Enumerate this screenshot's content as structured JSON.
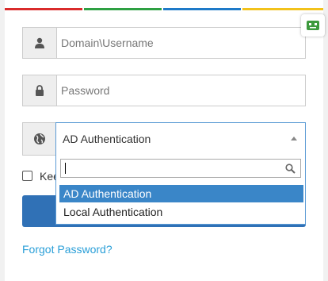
{
  "colors": {
    "stripe_red": "#d92b2b",
    "stripe_green": "#2ea043",
    "stripe_blue": "#1e7ac8",
    "stripe_yellow": "#f2c21b",
    "primary_button": "#3071b6",
    "selected_option": "#3a86c8",
    "link": "#2a9fd8"
  },
  "username": {
    "placeholder": "Domain\\Username",
    "icon": "user-icon"
  },
  "password": {
    "placeholder": "Password",
    "icon": "lock-icon"
  },
  "auth_select": {
    "icon": "globe-icon",
    "selected_value": "AD Authentication",
    "search_value": "",
    "options": [
      "AD Authentication",
      "Local Authentication"
    ]
  },
  "keep_signed_in": {
    "label": "Kee",
    "checked": false
  },
  "login_button": {
    "label": ""
  },
  "forgot_link": {
    "label": "Forgot Password?"
  },
  "extension": {
    "icon": "robot-extension-icon"
  }
}
